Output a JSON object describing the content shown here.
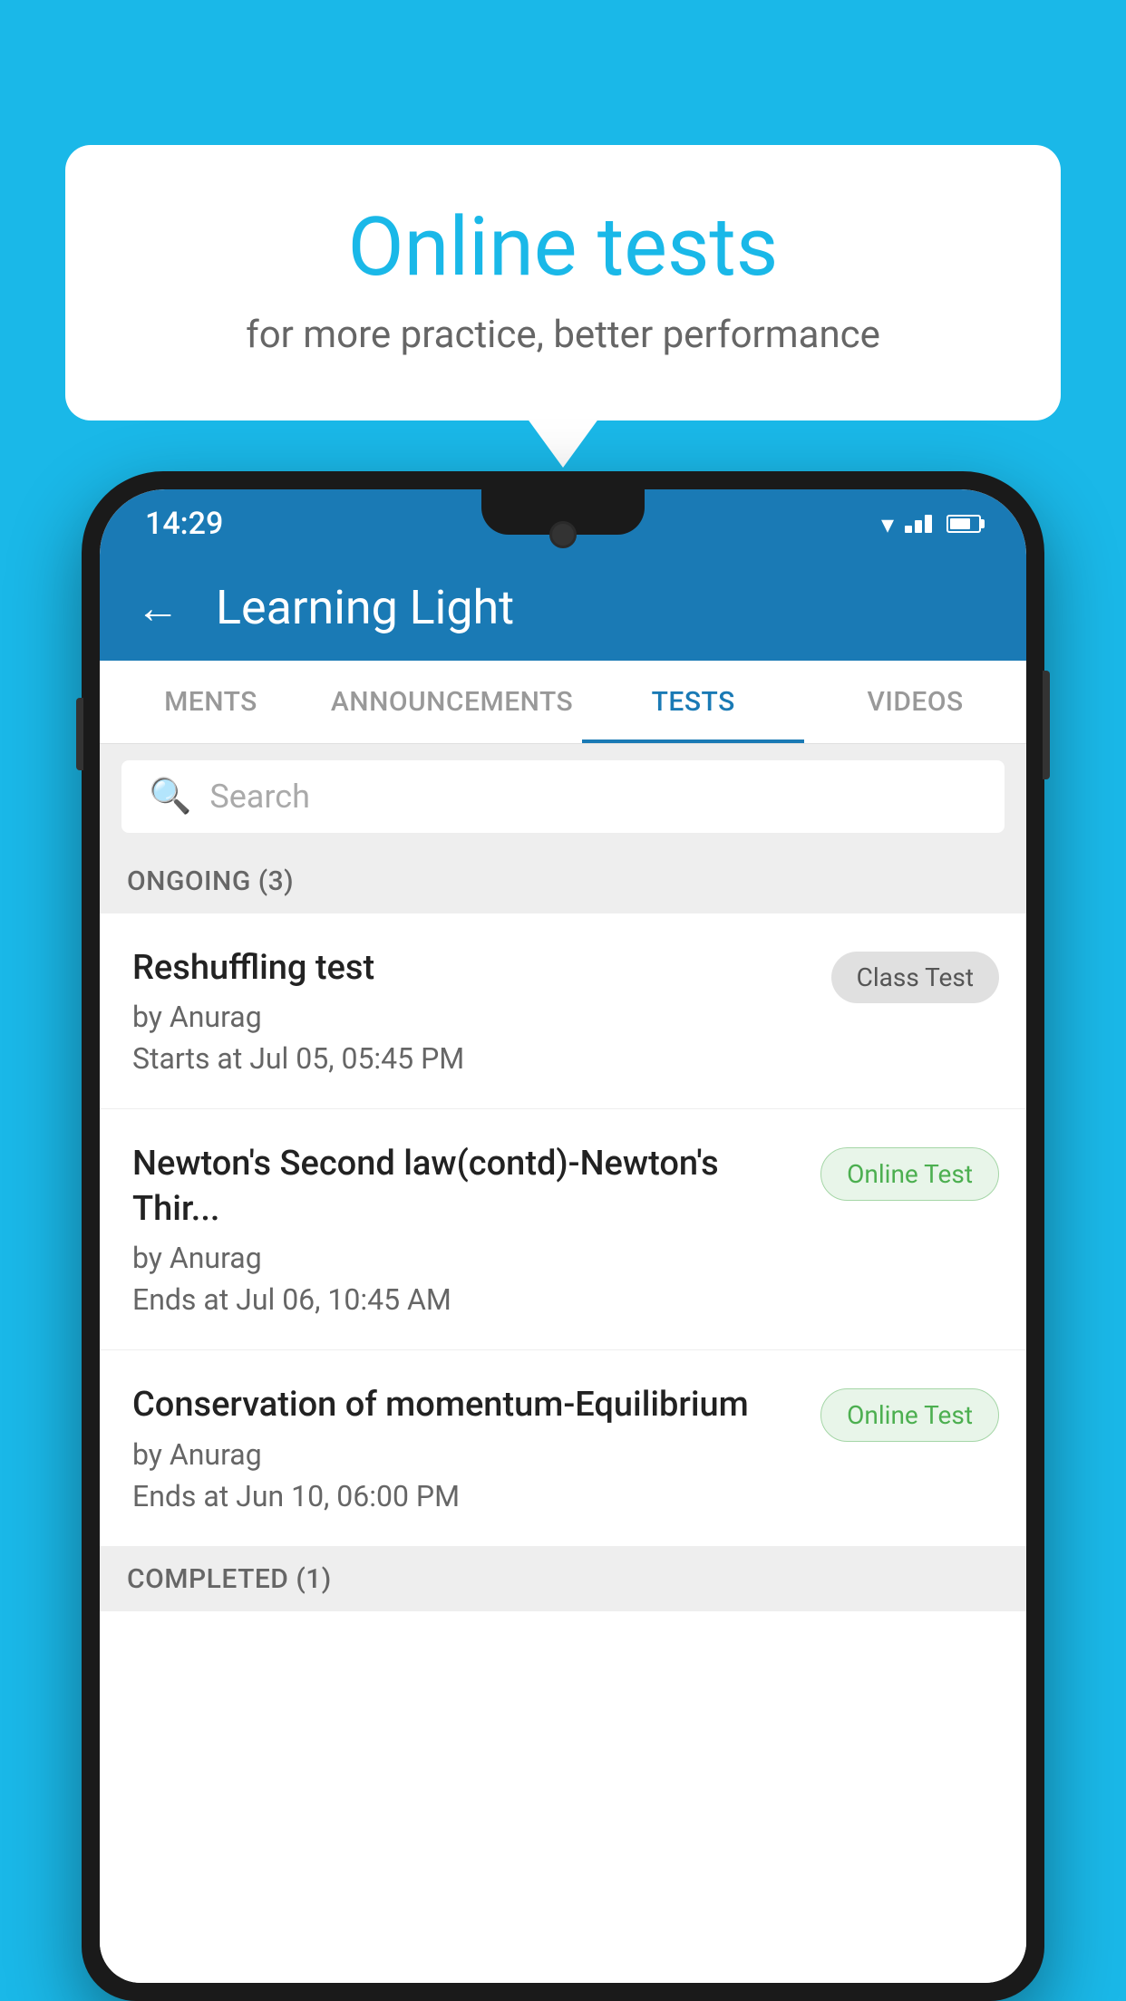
{
  "background_color": "#1ab8e8",
  "speech_bubble": {
    "title": "Online tests",
    "subtitle": "for more practice, better performance"
  },
  "phone": {
    "status_bar": {
      "time": "14:29"
    },
    "header": {
      "title": "Learning Light",
      "back_label": "←"
    },
    "tabs": [
      {
        "label": "MENTS",
        "active": false
      },
      {
        "label": "ANNOUNCEMENTS",
        "active": false
      },
      {
        "label": "TESTS",
        "active": true
      },
      {
        "label": "VIDEOS",
        "active": false
      }
    ],
    "search": {
      "placeholder": "Search"
    },
    "ongoing_section": {
      "label": "ONGOING (3)"
    },
    "test_items": [
      {
        "name": "Reshuffling test",
        "author": "by Anurag",
        "date": "Starts at  Jul 05, 05:45 PM",
        "badge": "Class Test",
        "badge_type": "class"
      },
      {
        "name": "Newton's Second law(contd)-Newton's Thir...",
        "author": "by Anurag",
        "date": "Ends at  Jul 06, 10:45 AM",
        "badge": "Online Test",
        "badge_type": "online"
      },
      {
        "name": "Conservation of momentum-Equilibrium",
        "author": "by Anurag",
        "date": "Ends at  Jun 10, 06:00 PM",
        "badge": "Online Test",
        "badge_type": "online"
      }
    ],
    "completed_section": {
      "label": "COMPLETED (1)"
    }
  }
}
